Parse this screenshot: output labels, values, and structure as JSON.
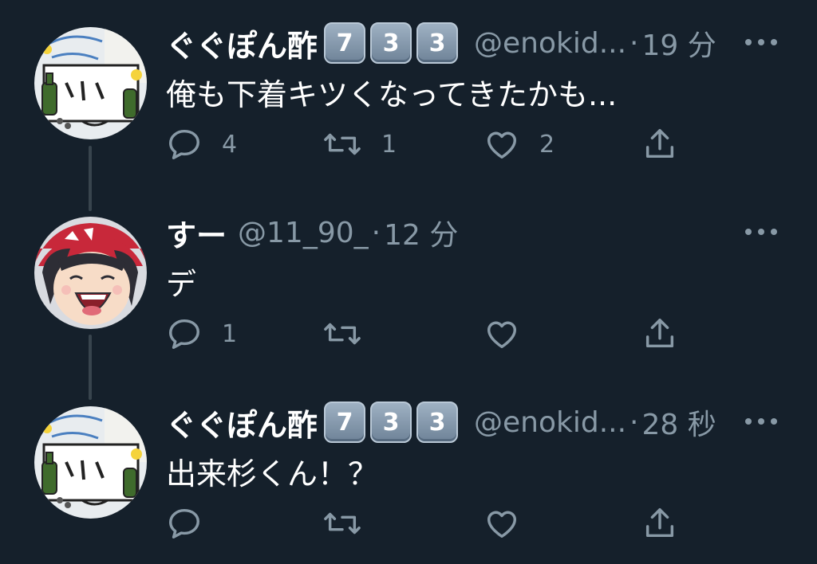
{
  "tweets": [
    {
      "name": "ぐぐぽん酢",
      "keycaps": [
        "7",
        "3",
        "3"
      ],
      "handle": "@enokid...",
      "separator": "·",
      "time": "19 分",
      "text": "俺も下着キツくなってきたかも...",
      "avatar_icon": "bottle-character-avatar",
      "replies": "4",
      "retweets": "1",
      "likes": "2"
    },
    {
      "name": "すー",
      "keycaps": [],
      "handle": "@11_90_",
      "separator": "·",
      "time": "12 分",
      "text": "デ",
      "avatar_icon": "laughing-girl-avatar",
      "replies": "1",
      "retweets": "",
      "likes": ""
    },
    {
      "name": "ぐぐぽん酢",
      "keycaps": [
        "7",
        "3",
        "3"
      ],
      "handle": "@enokid...",
      "separator": "·",
      "time": "28 秒",
      "text": "出来杉くん！？",
      "avatar_icon": "bottle-character-avatar",
      "replies": "",
      "retweets": "",
      "likes": ""
    }
  ],
  "colors": {
    "background": "#15202b",
    "text_primary": "#ffffff",
    "text_secondary": "#8899a6",
    "thread_line": "#38444d"
  },
  "icons": {
    "reply": "reply-icon",
    "retweet": "retweet-icon",
    "like": "heart-icon",
    "share": "share-icon",
    "more": "more-icon"
  }
}
